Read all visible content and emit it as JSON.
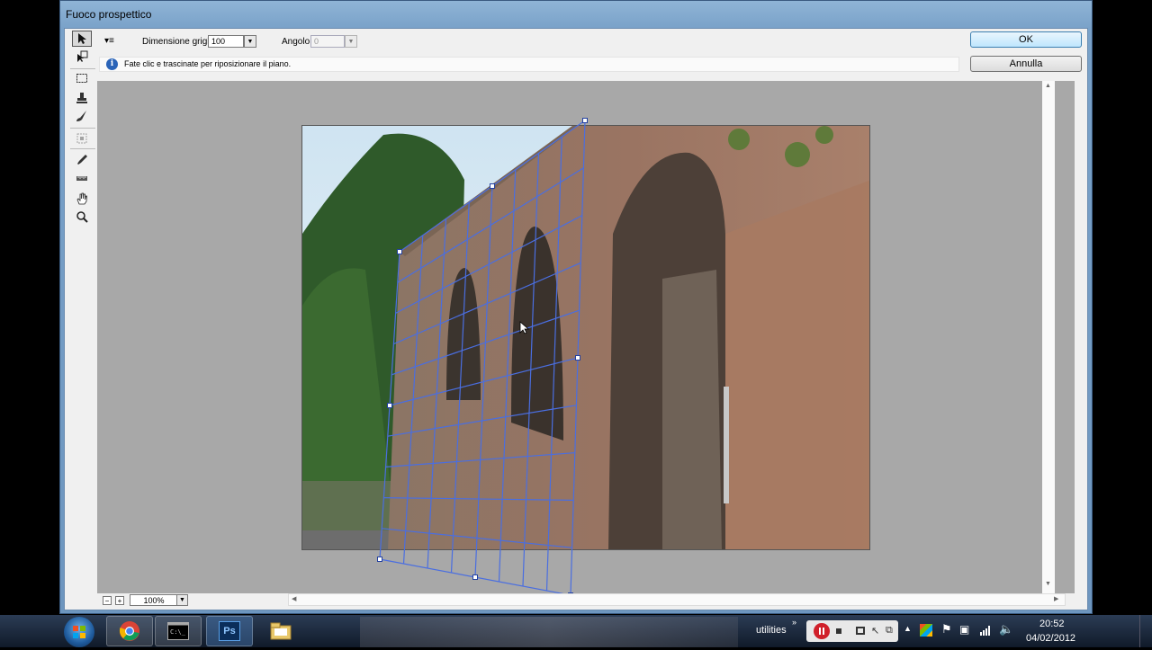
{
  "window": {
    "title": "Fuoco prospettico"
  },
  "options": {
    "grid_label": "Dimensione griglia:",
    "grid_value": "100",
    "angle_label": "Angolo:",
    "angle_value": "0",
    "info_text": "Fate clic e trascinate per riposizionare il piano."
  },
  "buttons": {
    "ok": "OK",
    "cancel": "Annulla"
  },
  "tools": [
    "edit-plane-tool",
    "create-plane-tool",
    "marquee-tool",
    "stamp-tool",
    "brush-tool",
    "transform-tool",
    "eyedropper-tool",
    "measure-tool",
    "hand-tool",
    "zoom-tool"
  ],
  "status": {
    "zoom": "100%",
    "zoom_out": "−",
    "zoom_in": "+"
  },
  "taskbar": {
    "apps": [
      "windows-explorer",
      "chrome",
      "command-prompt",
      "photoshop",
      "file-manager"
    ],
    "ps_label": "Ps",
    "utilities": "utilities",
    "time": "20:52",
    "date": "04/02/2012"
  },
  "colors": {
    "grid": "#4a6ee0",
    "ok_border": "#3c7fb1"
  }
}
